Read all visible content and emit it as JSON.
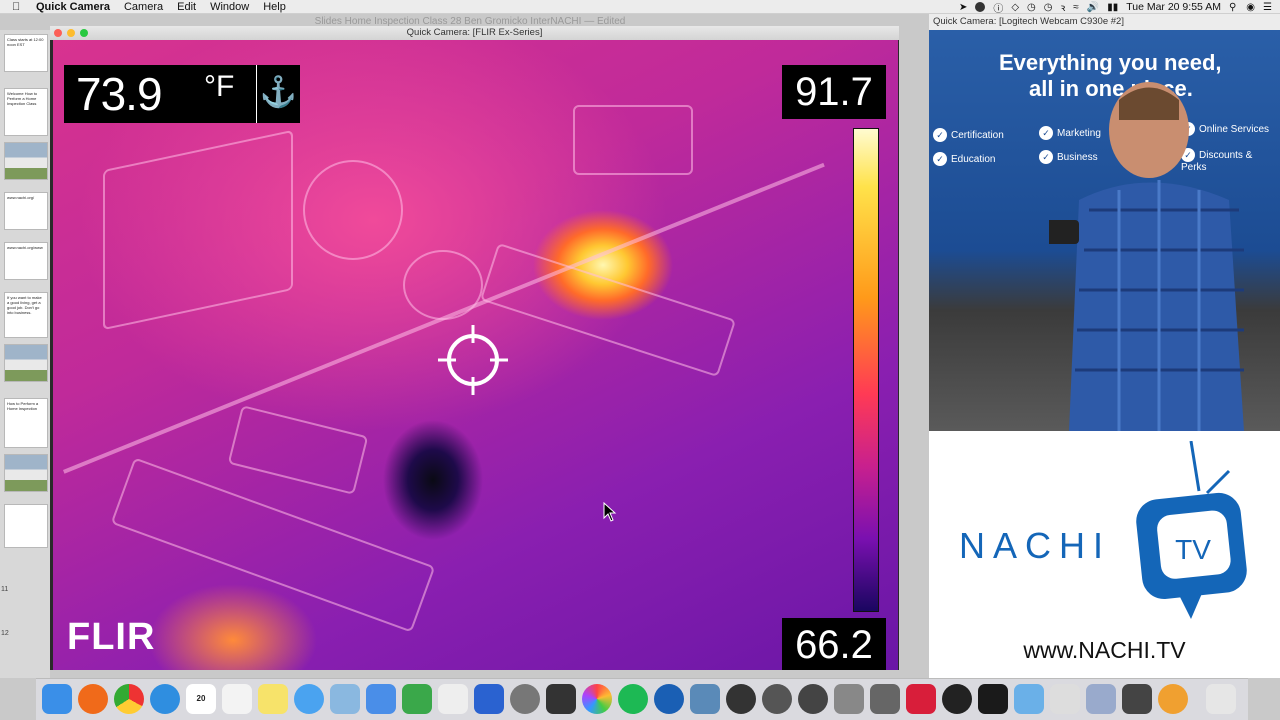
{
  "menubar": {
    "app_name": "Quick Camera",
    "menus": [
      "Camera",
      "Edit",
      "Window",
      "Help"
    ],
    "clock": "Tue Mar 20  9:55 AM"
  },
  "background_window": {
    "title": "Slides Home Inspection Class 28 Ben Gromicko InterNACHI — Edited"
  },
  "slides": {
    "thumbnails": [
      {
        "text": "Class starts at 12:00 noon EST",
        "style": "plain"
      },
      {
        "text": "Welcome How to Perform a Home Inspection Class",
        "style": "plain"
      },
      {
        "text": "",
        "style": "house"
      },
      {
        "text": "www.nachi.org/",
        "style": "plain"
      },
      {
        "text": "www.nachi.org/www",
        "style": "plain"
      },
      {
        "text": "If you want to make a good living, get a good job. Don't go into business.",
        "style": "plain"
      },
      {
        "text": "",
        "style": "house"
      },
      {
        "text": "How to Perform a Home Inspection",
        "style": "plain"
      },
      {
        "text": "",
        "style": "house"
      },
      {
        "text": "",
        "style": "plain"
      }
    ],
    "numbers": [
      "11",
      "12"
    ]
  },
  "flir_window": {
    "title": "Quick Camera: [FLIR Ex-Series]",
    "spot_temp": "73.9",
    "unit": "°F",
    "scale_max": "91.7",
    "scale_min": "66.2",
    "logo": "FLIR"
  },
  "webcam_window": {
    "title": "Quick Camera: [Logitech Webcam C930e #2]",
    "banner_line1": "Everything you need,",
    "banner_line2": "all in one place.",
    "checks": [
      "Certification",
      "Education",
      "Marketing",
      "Business",
      "Online Services",
      "Discounts & Perks"
    ]
  },
  "nachi": {
    "word": "NACHI",
    "tv": "TV",
    "url": "www.NACHI.TV"
  },
  "dock": {
    "calendar_day": "20",
    "icons": [
      "finder-icon",
      "firefox-icon",
      "chrome-icon",
      "safari-icon",
      "calendar-icon",
      "textedit-icon",
      "notes-icon",
      "messages-icon",
      "preview-icon",
      "keynote-icon",
      "numbers-icon",
      "scrivener-icon",
      "voice-icon",
      "system-preferences-icon",
      "final-cut-icon",
      "photos-icon",
      "spotify-icon",
      "quicktime-icon",
      "magnifier-icon",
      "camera-icon",
      "screenflow-icon",
      "obs-icon",
      "app-icon",
      "pencil-icon",
      "q-icon",
      "stop-icon",
      "terminal-icon",
      "folder-icon",
      "mail-icon",
      "downloads-icon",
      "airplay-icon",
      "flower-icon",
      "trash-icon"
    ]
  },
  "colors": {
    "accent": "#1466b8",
    "scale_hot": "#fffbd0",
    "scale_cold": "#1a0660"
  }
}
